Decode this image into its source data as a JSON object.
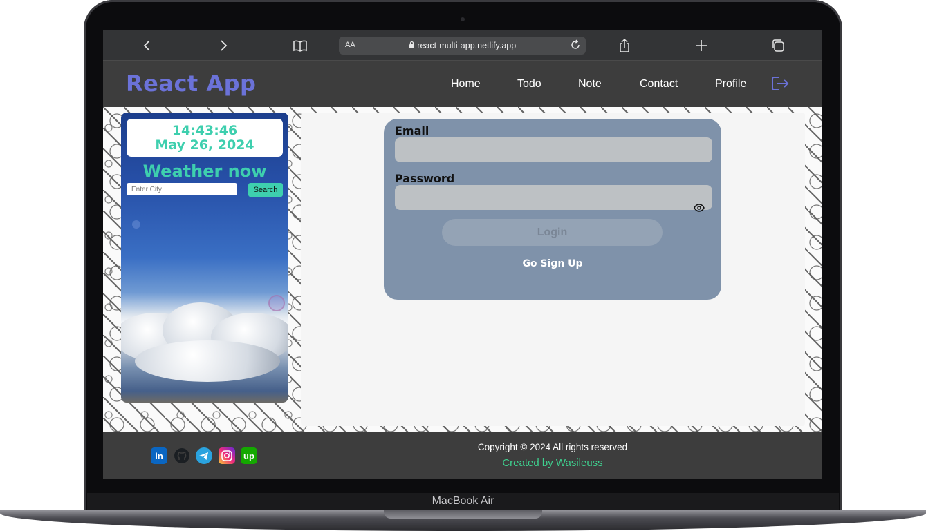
{
  "device": {
    "label": "MacBook Air"
  },
  "browser": {
    "text_size_label": "AA",
    "url": "react-multi-app.netlify.app",
    "icons": [
      "back-icon",
      "forward-icon",
      "bookmarks-icon",
      "lock-icon",
      "reload-icon",
      "share-icon",
      "new-tab-icon",
      "tabs-icon"
    ]
  },
  "nav": {
    "brand": "React App",
    "links": [
      "Home",
      "Todo",
      "Note",
      "Contact",
      "Profile"
    ],
    "logout_icon": "logout-icon"
  },
  "weather": {
    "time": "14:43:46",
    "date": "May 26, 2024",
    "title": "Weather now",
    "city_placeholder": "Enter City",
    "search_label": "Search"
  },
  "login": {
    "email_label": "Email",
    "email_value": "",
    "password_label": "Password",
    "password_value": "",
    "login_label": "Login",
    "signup_label": "Go Sign Up"
  },
  "footer": {
    "social": [
      {
        "name": "linkedin-icon",
        "glyph": "in",
        "color": "#0a66c2"
      },
      {
        "name": "github-icon",
        "glyph": "",
        "color": "#1b1f23"
      },
      {
        "name": "telegram-icon",
        "glyph": "",
        "color": "#2aa3df"
      },
      {
        "name": "instagram-icon",
        "glyph": "",
        "color": "#dd2a7b"
      },
      {
        "name": "upwork-icon",
        "glyph": "up",
        "color": "#14a800"
      }
    ],
    "copyright": "Copyright © 2024 All rights reserved",
    "created_by": "Created by Wasileuss"
  },
  "colors": {
    "accent": "#3ecfae",
    "brand": "#6b72d8",
    "card": "#7f92aa",
    "nav": "#3d3d3d"
  }
}
